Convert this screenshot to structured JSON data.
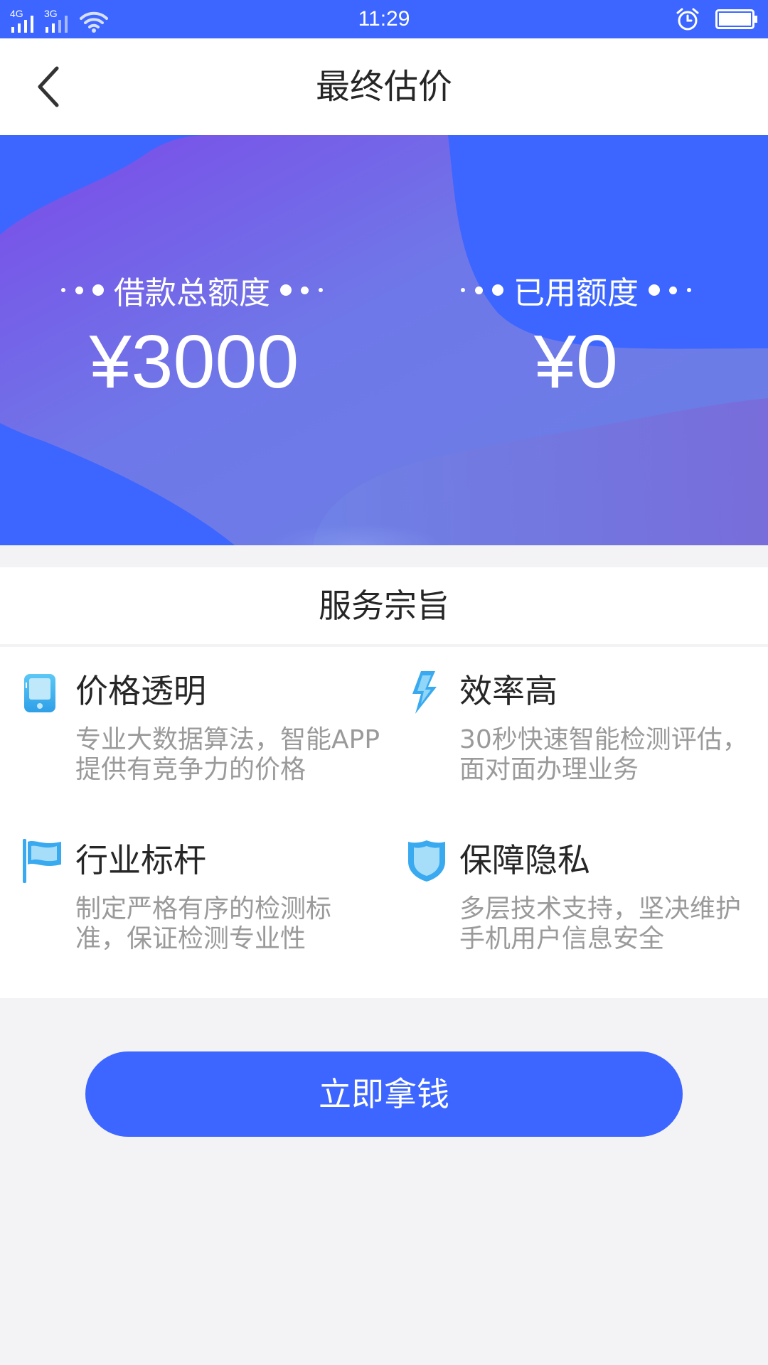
{
  "status_bar": {
    "time": "11:29",
    "network_1": "4G",
    "network_2": "3G",
    "icons": [
      "signal-icon",
      "wifi-icon",
      "alarm-icon",
      "battery-icon"
    ]
  },
  "nav": {
    "title": "最终估价",
    "back_icon": "chevron-left-icon"
  },
  "banner": {
    "total_label": "借款总额度",
    "total_value": "¥3000",
    "used_label": "已用额度",
    "used_value": "¥0"
  },
  "service": {
    "title": "服务宗旨",
    "features": [
      {
        "title": "价格透明",
        "desc": "专业大数据算法，智能APP提供有竞争力的价格",
        "icon": "phone-icon"
      },
      {
        "title": "效率高",
        "desc": "30秒快速智能检测评估，面对面办理业务",
        "icon": "lightning-icon"
      },
      {
        "title": "行业标杆",
        "desc": "制定严格有序的检测标准，保证检测专业性",
        "icon": "flag-icon"
      },
      {
        "title": "保障隐私",
        "desc": "多层技术支持，坚决维护手机用户信息安全",
        "icon": "shield-icon"
      }
    ]
  },
  "cta": {
    "label": "立即拿钱"
  },
  "colors": {
    "primary": "#3c66ff",
    "background": "#f3f3f5",
    "text_dark": "#262626",
    "text_gray": "#9a9a9a",
    "icon_blue": "#39a9f0"
  }
}
